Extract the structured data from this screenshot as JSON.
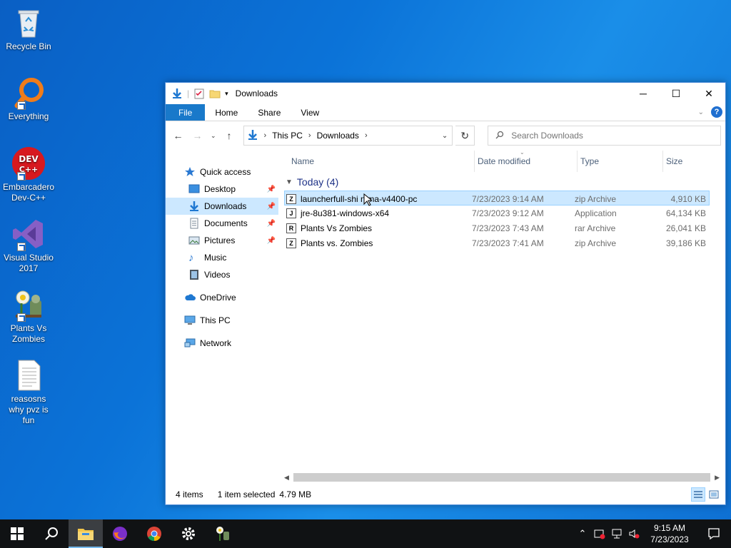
{
  "desktop": {
    "icons": [
      {
        "label": "Recycle Bin",
        "icon": "recycle-bin-icon"
      },
      {
        "label": "Everything",
        "icon": "everything-search-icon"
      },
      {
        "label": "Embarcadero Dev-C++",
        "icon": "devcpp-icon",
        "badge": "DEV C++"
      },
      {
        "label": "Visual Studio 2017",
        "icon": "visual-studio-icon"
      },
      {
        "label": "Plants Vs Zombies",
        "icon": "plants-vs-zombies-icon"
      },
      {
        "label": "reasosns why pvz is fun",
        "icon": "text-document-icon"
      }
    ]
  },
  "window": {
    "title": "Downloads",
    "controls": {
      "minimize": "─",
      "maximize": "☐",
      "close": "✕"
    },
    "ribbon_tabs": [
      "File",
      "Home",
      "Share",
      "View"
    ],
    "help": "?",
    "address": {
      "crumbs": [
        "This PC",
        "Downloads"
      ]
    },
    "search": {
      "placeholder": "Search Downloads"
    },
    "nav_pane": {
      "quick_access": "Quick access",
      "items": [
        {
          "label": "Desktop",
          "pinned": true
        },
        {
          "label": "Downloads",
          "pinned": true,
          "selected": true
        },
        {
          "label": "Documents",
          "pinned": true
        },
        {
          "label": "Pictures",
          "pinned": true
        },
        {
          "label": "Music",
          "pinned": false
        },
        {
          "label": "Videos",
          "pinned": false
        }
      ],
      "onedrive": "OneDrive",
      "this_pc": "This PC",
      "network": "Network"
    },
    "columns": {
      "name": "Name",
      "date": "Date modified",
      "type": "Type",
      "size": "Size"
    },
    "group": "Today (4)",
    "files": [
      {
        "name": "launcherfull-shi  nima-v4400-pc",
        "date": "7/23/2023 9:14 AM",
        "type": "zip Archive",
        "size": "4,910 KB",
        "icon": "Z",
        "selected": true
      },
      {
        "name": "jre-8u381-windows-x64",
        "date": "7/23/2023 9:12 AM",
        "type": "Application",
        "size": "64,134 KB",
        "icon": "J"
      },
      {
        "name": "Plants Vs Zombies",
        "date": "7/23/2023 7:43 AM",
        "type": "rar Archive",
        "size": "26,041 KB",
        "icon": "R"
      },
      {
        "name": "Plants vs. Zombies",
        "date": "7/23/2023 7:41 AM",
        "type": "zip Archive",
        "size": "39,186 KB",
        "icon": "Z"
      }
    ],
    "status": {
      "count": "4 items",
      "selected": "1 item selected",
      "size": "4.79 MB"
    }
  },
  "taskbar": {
    "clock_time": "9:15 AM",
    "clock_date": "7/23/2023"
  }
}
